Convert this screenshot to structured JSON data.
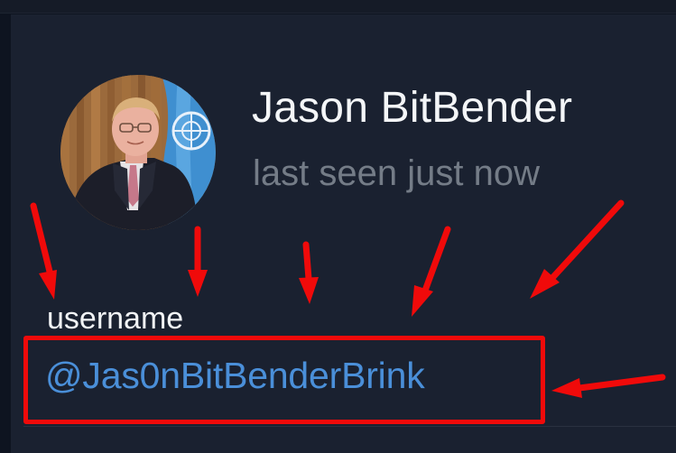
{
  "profile": {
    "name": "Jason BitBender",
    "status": "last seen just now",
    "username_label": "username",
    "username": "@Jas0nBitBenderBrink"
  },
  "colors": {
    "background": "#1a2130",
    "name_text": "#f4f6f8",
    "status_text": "#747c87",
    "username_link": "#4a8fd9",
    "annotation_red": "#f00a0a"
  },
  "annotations": {
    "type": "red-arrows-and-box",
    "arrow_count": 7
  }
}
